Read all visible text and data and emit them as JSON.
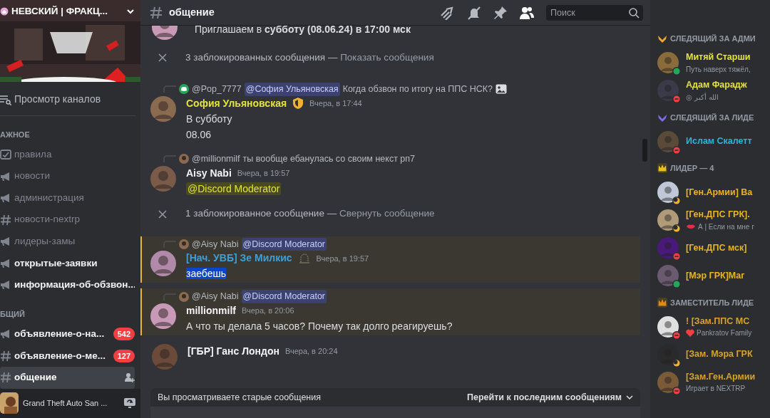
{
  "server": {
    "name": "НЕВСКИЙ | ФРАКЦ..."
  },
  "sidebar": {
    "browse": "Просмотр каналов",
    "categories": [
      {
        "name": "АЖНОЕ",
        "channels": [
          {
            "name": "правила",
            "kind": "rules",
            "unread": false,
            "selected": false
          },
          {
            "name": "новости",
            "kind": "announce",
            "unread": false,
            "selected": false
          },
          {
            "name": "администрация",
            "kind": "announce",
            "unread": false,
            "selected": false
          },
          {
            "name": "новости-nextrp",
            "kind": "text",
            "unread": false,
            "selected": false
          },
          {
            "name": "лидеры-замы",
            "kind": "announce",
            "unread": false,
            "selected": false
          },
          {
            "name": "открытые-заявки",
            "kind": "announce",
            "unread": true,
            "selected": false
          },
          {
            "name": "информация-об-обзвон...",
            "kind": "announce",
            "unread": true,
            "selected": false
          }
        ]
      },
      {
        "name": "БЩИЙ",
        "channels": [
          {
            "name": "объявление-о-на...",
            "kind": "announce",
            "unread": true,
            "selected": false,
            "badge": "542"
          },
          {
            "name": "объявление-о-ме...",
            "kind": "text",
            "unread": true,
            "selected": false,
            "badge": "127"
          },
          {
            "name": "общение",
            "kind": "text",
            "unread": true,
            "selected": true
          }
        ]
      }
    ],
    "activity": {
      "title": "Grand Theft Auto San ..."
    }
  },
  "channel": {
    "name": "общение",
    "search": {
      "placeholder": "Поиск"
    }
  },
  "messages": [
    {
      "kind": "message",
      "lines": [
        {
          "kind": "plain",
          "text": "Приглашаем в **субботу (08.06.24) в 17:00 мск**"
        }
      ],
      "highlighted": false
    },
    {
      "kind": "blocked",
      "text": "3 заблокированных сообщения —",
      "link": "Показать сообщения"
    },
    {
      "kind": "message",
      "reply": {
        "kind": "discord",
        "user": "@Pop_7777",
        "mention": "@София Ульяновская",
        "text": "Когда обзвон по итогу на ППС НСК?",
        "attachment": true
      },
      "author": "София Ульяновская",
      "color": "#e3e33b",
      "badge": {
        "kind": "shield"
      },
      "time": "Вчера, в 17:44",
      "lines": [
        {
          "kind": "plain",
          "text": "В субботу"
        },
        {
          "kind": "plain",
          "text": "08.06"
        }
      ],
      "highlighted": false
    },
    {
      "kind": "message",
      "reply": {
        "user": "@millionmilf",
        "text": "ты вообще ебанулась со своим некст рп7"
      },
      "author": "Aisy Nabi",
      "color": "#f2f3f5",
      "time": "Вчера, в 19:57",
      "lines": [
        {
          "kind": "role-mention",
          "text": "@Discord Moderator"
        }
      ],
      "highlighted": false
    },
    {
      "kind": "blocked",
      "text": "1 заблокированное сообщение —",
      "link": "Свернуть сообщение"
    },
    {
      "kind": "message",
      "reply": {
        "user": "@Aisy Nabi",
        "mention": "@Discord Moderator"
      },
      "author": "[Нач. УВБ] Зе Милкис",
      "color": "#3d9fd8",
      "badge": {
        "kind": "bell"
      },
      "time": "Вчера, в 19:57",
      "lines": [
        {
          "kind": "selected",
          "text": "заебешь"
        }
      ],
      "highlighted": true
    },
    {
      "kind": "message",
      "reply": {
        "user": "@Aisy Nabi",
        "mention": "@Discord Moderator"
      },
      "author": "millionmilf",
      "color": "#f2f3f5",
      "time": "Вчера, в 20:06",
      "lines": [
        {
          "kind": "plain",
          "text": "А что ты делала 5 часов? Почему так долго реагируешь?"
        }
      ],
      "highlighted": true
    },
    {
      "kind": "message",
      "author": "[ГБР] Ганс Лондон",
      "color": "#f2f3f5",
      "time": "Вчера, в 20:24",
      "highlighted": false
    }
  ],
  "jump_bar": {
    "text": "Вы просматриваете старые сообщения",
    "action": "Перейти к последним сообщениям"
  },
  "members": [
    {
      "title": "СЛЕДЯЩИЙ ЗА АДМИ",
      "kind": "chevron",
      "color": "#f0a830",
      "items": [
        {
          "name": "Митяй Старши",
          "color": "#e3e33b",
          "kind": "online",
          "activity": {
            "text": "Путь наверх тяжёл,"
          }
        },
        {
          "name": "Адам Фарадж",
          "color": "#e3e33b",
          "kind": "dnd",
          "activity": {
            "text": "◎ الله أكبر"
          }
        }
      ]
    },
    {
      "title": "СЛЕДЯЩИЙ ЗА ЛИДЕ",
      "kind": "chevron",
      "color": "#7b6cf0",
      "items": [
        {
          "name": "Ислам Скалетт",
          "color": "#29b6d9",
          "kind": "dnd"
        }
      ]
    },
    {
      "title": "ЛИДЕР — 4",
      "kind": "crown",
      "color": "#e8c21a",
      "items": [
        {
          "name": "[Ген.Армии] Ва",
          "color": "#e8b51c",
          "kind": "idle"
        },
        {
          "name": "[Ген.ДПС ГРК].",
          "color": "#e8b51c",
          "kind": "idle",
          "activity": {
            "text": "А | Если на мне г",
            "kind": "lips"
          }
        },
        {
          "name": "[Ген.ДПС мск]",
          "color": "#e8b51c",
          "kind": "dnd"
        },
        {
          "name": "[Мэр ГРК]Маг",
          "color": "#e8b51c",
          "kind": "online"
        }
      ]
    },
    {
      "title": "ЗАМЕСТИТЕЛЬ ЛИДЕ",
      "kind": "crown",
      "color": "#e08a1a",
      "items": [
        {
          "name": "! [Зам.ППС МС",
          "color": "#d9a02a",
          "kind": "dnd",
          "activity": {
            "text": "Pankratov Family",
            "kind": "heart"
          }
        },
        {
          "name": "[Зам. Мэра ГРК",
          "color": "#d9a02a",
          "kind": "idle"
        },
        {
          "name": "[Зам.Ген.Армии",
          "color": "#d9a02a",
          "kind": "dnd",
          "activity": {
            "text": "Играет в NEXTRP"
          }
        }
      ]
    }
  ]
}
